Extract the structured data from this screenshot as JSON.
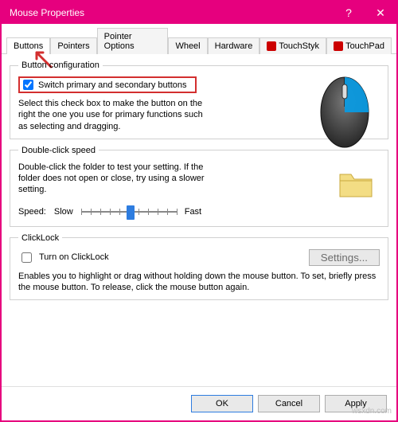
{
  "window": {
    "title": "Mouse Properties"
  },
  "tabs": {
    "items": [
      {
        "label": "Buttons"
      },
      {
        "label": "Pointers"
      },
      {
        "label": "Pointer Options"
      },
      {
        "label": "Wheel"
      },
      {
        "label": "Hardware"
      },
      {
        "label": "TouchStyk"
      },
      {
        "label": "TouchPad"
      }
    ]
  },
  "buttonConfig": {
    "legend": "Button configuration",
    "switchLabel": "Switch primary and secondary buttons",
    "hint": "Select this check box to make the button on the right the one you use for primary functions such as selecting and dragging."
  },
  "doubleClick": {
    "legend": "Double-click speed",
    "hint": "Double-click the folder to test your setting. If the folder does not open or close, try using a slower setting.",
    "speedLabel": "Speed:",
    "slow": "Slow",
    "fast": "Fast"
  },
  "clickLock": {
    "legend": "ClickLock",
    "turnOn": "Turn on ClickLock",
    "settings": "Settings...",
    "hint": "Enables you to highlight or drag without holding down the mouse button. To set, briefly press the mouse button. To release, click the mouse button again."
  },
  "footer": {
    "ok": "OK",
    "cancel": "Cancel",
    "apply": "Apply"
  },
  "watermark": "wsxdn.com"
}
